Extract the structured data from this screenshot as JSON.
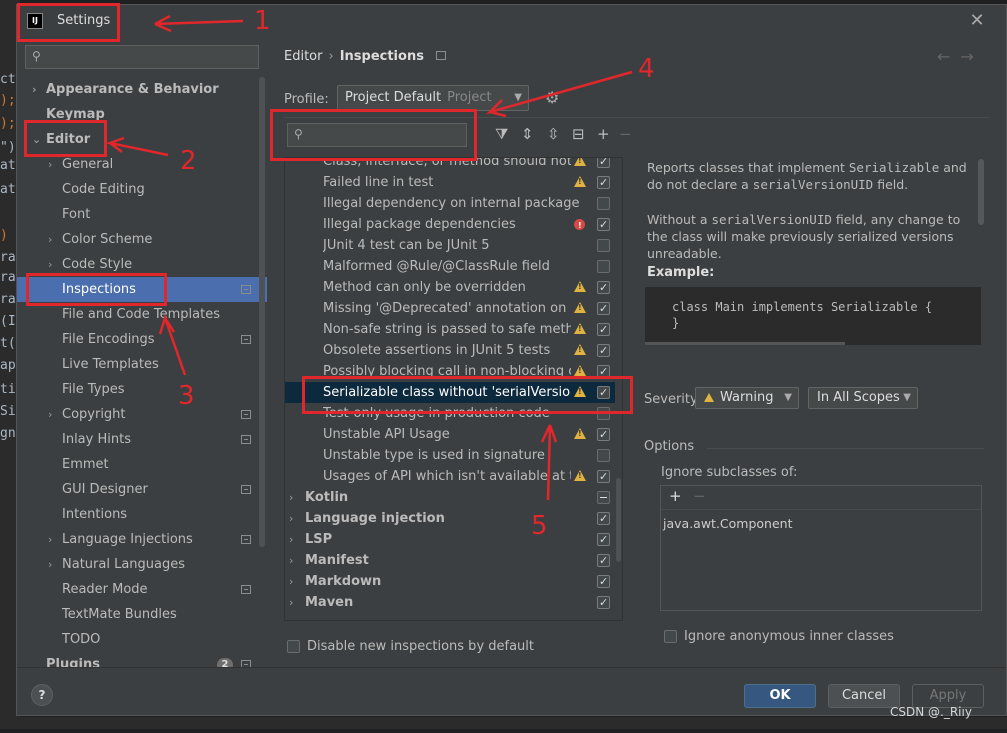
{
  "window": {
    "title": "Settings",
    "app_icon_label": "IJ",
    "close_icon": "close-icon"
  },
  "left": {
    "search_placeholder": "",
    "items": [
      {
        "label": "Appearance & Behavior",
        "bold": true,
        "expandable": true,
        "expanded": false
      },
      {
        "label": "Keymap",
        "bold": true
      },
      {
        "label": "Editor",
        "bold": true,
        "expandable": true,
        "expanded": true
      },
      {
        "label": "General",
        "expandable": true
      },
      {
        "label": "Code Editing"
      },
      {
        "label": "Font"
      },
      {
        "label": "Color Scheme",
        "expandable": true
      },
      {
        "label": "Code Style",
        "expandable": true
      },
      {
        "label": "Inspections",
        "selected": true,
        "badge": true
      },
      {
        "label": "File and Code Templates"
      },
      {
        "label": "File Encodings",
        "badge": true
      },
      {
        "label": "Live Templates"
      },
      {
        "label": "File Types"
      },
      {
        "label": "Copyright",
        "expandable": true,
        "badge": true
      },
      {
        "label": "Inlay Hints",
        "badge": true
      },
      {
        "label": "Emmet"
      },
      {
        "label": "GUI Designer",
        "badge": true
      },
      {
        "label": "Intentions"
      },
      {
        "label": "Language Injections",
        "expandable": true,
        "badge": true
      },
      {
        "label": "Natural Languages",
        "expandable": true
      },
      {
        "label": "Reader Mode",
        "badge": true
      },
      {
        "label": "TextMate Bundles"
      },
      {
        "label": "TODO"
      },
      {
        "label": "Plugins",
        "bold": true,
        "count": "2",
        "badge": true
      }
    ]
  },
  "right": {
    "breadcrumb": [
      "Editor",
      "Inspections"
    ],
    "profile_label": "Profile:",
    "profile_value": "Project Default",
    "profile_scope": "Project",
    "search_placeholder": "",
    "inspections": [
      {
        "label": "Class, interface, or method should not be",
        "icon": "warn",
        "checked": true
      },
      {
        "label": "Failed line in test",
        "icon": "warn",
        "checked": true
      },
      {
        "label": "Illegal dependency on internal package",
        "icon": "",
        "checked": false
      },
      {
        "label": "Illegal package dependencies",
        "icon": "err",
        "checked": true
      },
      {
        "label": "JUnit 4 test can be JUnit 5",
        "icon": "",
        "checked": false
      },
      {
        "label": "Malformed @Rule/@ClassRule field",
        "icon": "",
        "checked": false
      },
      {
        "label": "Method can only be overridden",
        "icon": "warn",
        "checked": true
      },
      {
        "label": "Missing '@Deprecated' annotation on sch",
        "icon": "warn",
        "checked": true
      },
      {
        "label": "Non-safe string is passed to safe method",
        "icon": "warn",
        "checked": true
      },
      {
        "label": "Obsolete assertions in JUnit 5 tests",
        "icon": "warn",
        "checked": true
      },
      {
        "label": "Possibly blocking call in non-blocking con",
        "icon": "warn",
        "checked": true
      },
      {
        "label": "Serializable class without 'serialVersionUID",
        "icon": "warn",
        "checked": true,
        "selected": true
      },
      {
        "label": "Test-only usage in production code",
        "icon": "",
        "checked": false
      },
      {
        "label": "Unstable API Usage",
        "icon": "warn",
        "checked": true
      },
      {
        "label": "Unstable type is used in signature",
        "icon": "",
        "checked": false
      },
      {
        "label": "Usages of API which isn't available at the c",
        "icon": "warn",
        "checked": true
      }
    ],
    "groups": [
      {
        "label": "Kotlin",
        "state": "mixed"
      },
      {
        "label": "Language injection",
        "state": "on"
      },
      {
        "label": "LSP",
        "state": "on"
      },
      {
        "label": "Manifest",
        "state": "on"
      },
      {
        "label": "Markdown",
        "state": "on"
      },
      {
        "label": "Maven",
        "state": "on"
      }
    ],
    "disable_new_label": "Disable new inspections by default",
    "description": {
      "p1_a": "Reports classes that implement ",
      "p1_code1": "Serializable",
      "p1_b": " and do not declare a ",
      "p1_code2": "serialVersionUID",
      "p1_c": " field.",
      "p2_a": "Without a ",
      "p2_code": "serialVersionUID",
      "p2_b": " field, any change to the class will make previously serialized versions unreadable.",
      "example_label": "Example:",
      "example_line1": "class Main implements Serializable {",
      "example_line2": "}"
    },
    "severity_label": "Severity:",
    "severity_value": "Warning",
    "scope_value": "In All Scopes",
    "options_label": "Options",
    "ignore_subclasses_label": "Ignore subclasses of:",
    "ignore_subclasses_item": "java.awt.Component",
    "ignore_anonymous_label": "Ignore anonymous inner classes"
  },
  "footer": {
    "help": "?",
    "ok": "OK",
    "cancel": "Cancel",
    "apply": "Apply"
  },
  "annotations": {
    "n1": "1",
    "n2": "2",
    "n3": "3",
    "n4": "4",
    "n5": "5",
    "color": "#e0272b"
  },
  "watermark": "CSDN @._Ri̇̇ıy",
  "background_code": [
    "ct",
    ");",
    ");",
    "\")",
    "at",
    "at",
    ")",
    "ra",
    "ra",
    "ra",
    "(I",
    "t(",
    "ap",
    "ti",
    "Si",
    "gn",
    "cket'"
  ]
}
